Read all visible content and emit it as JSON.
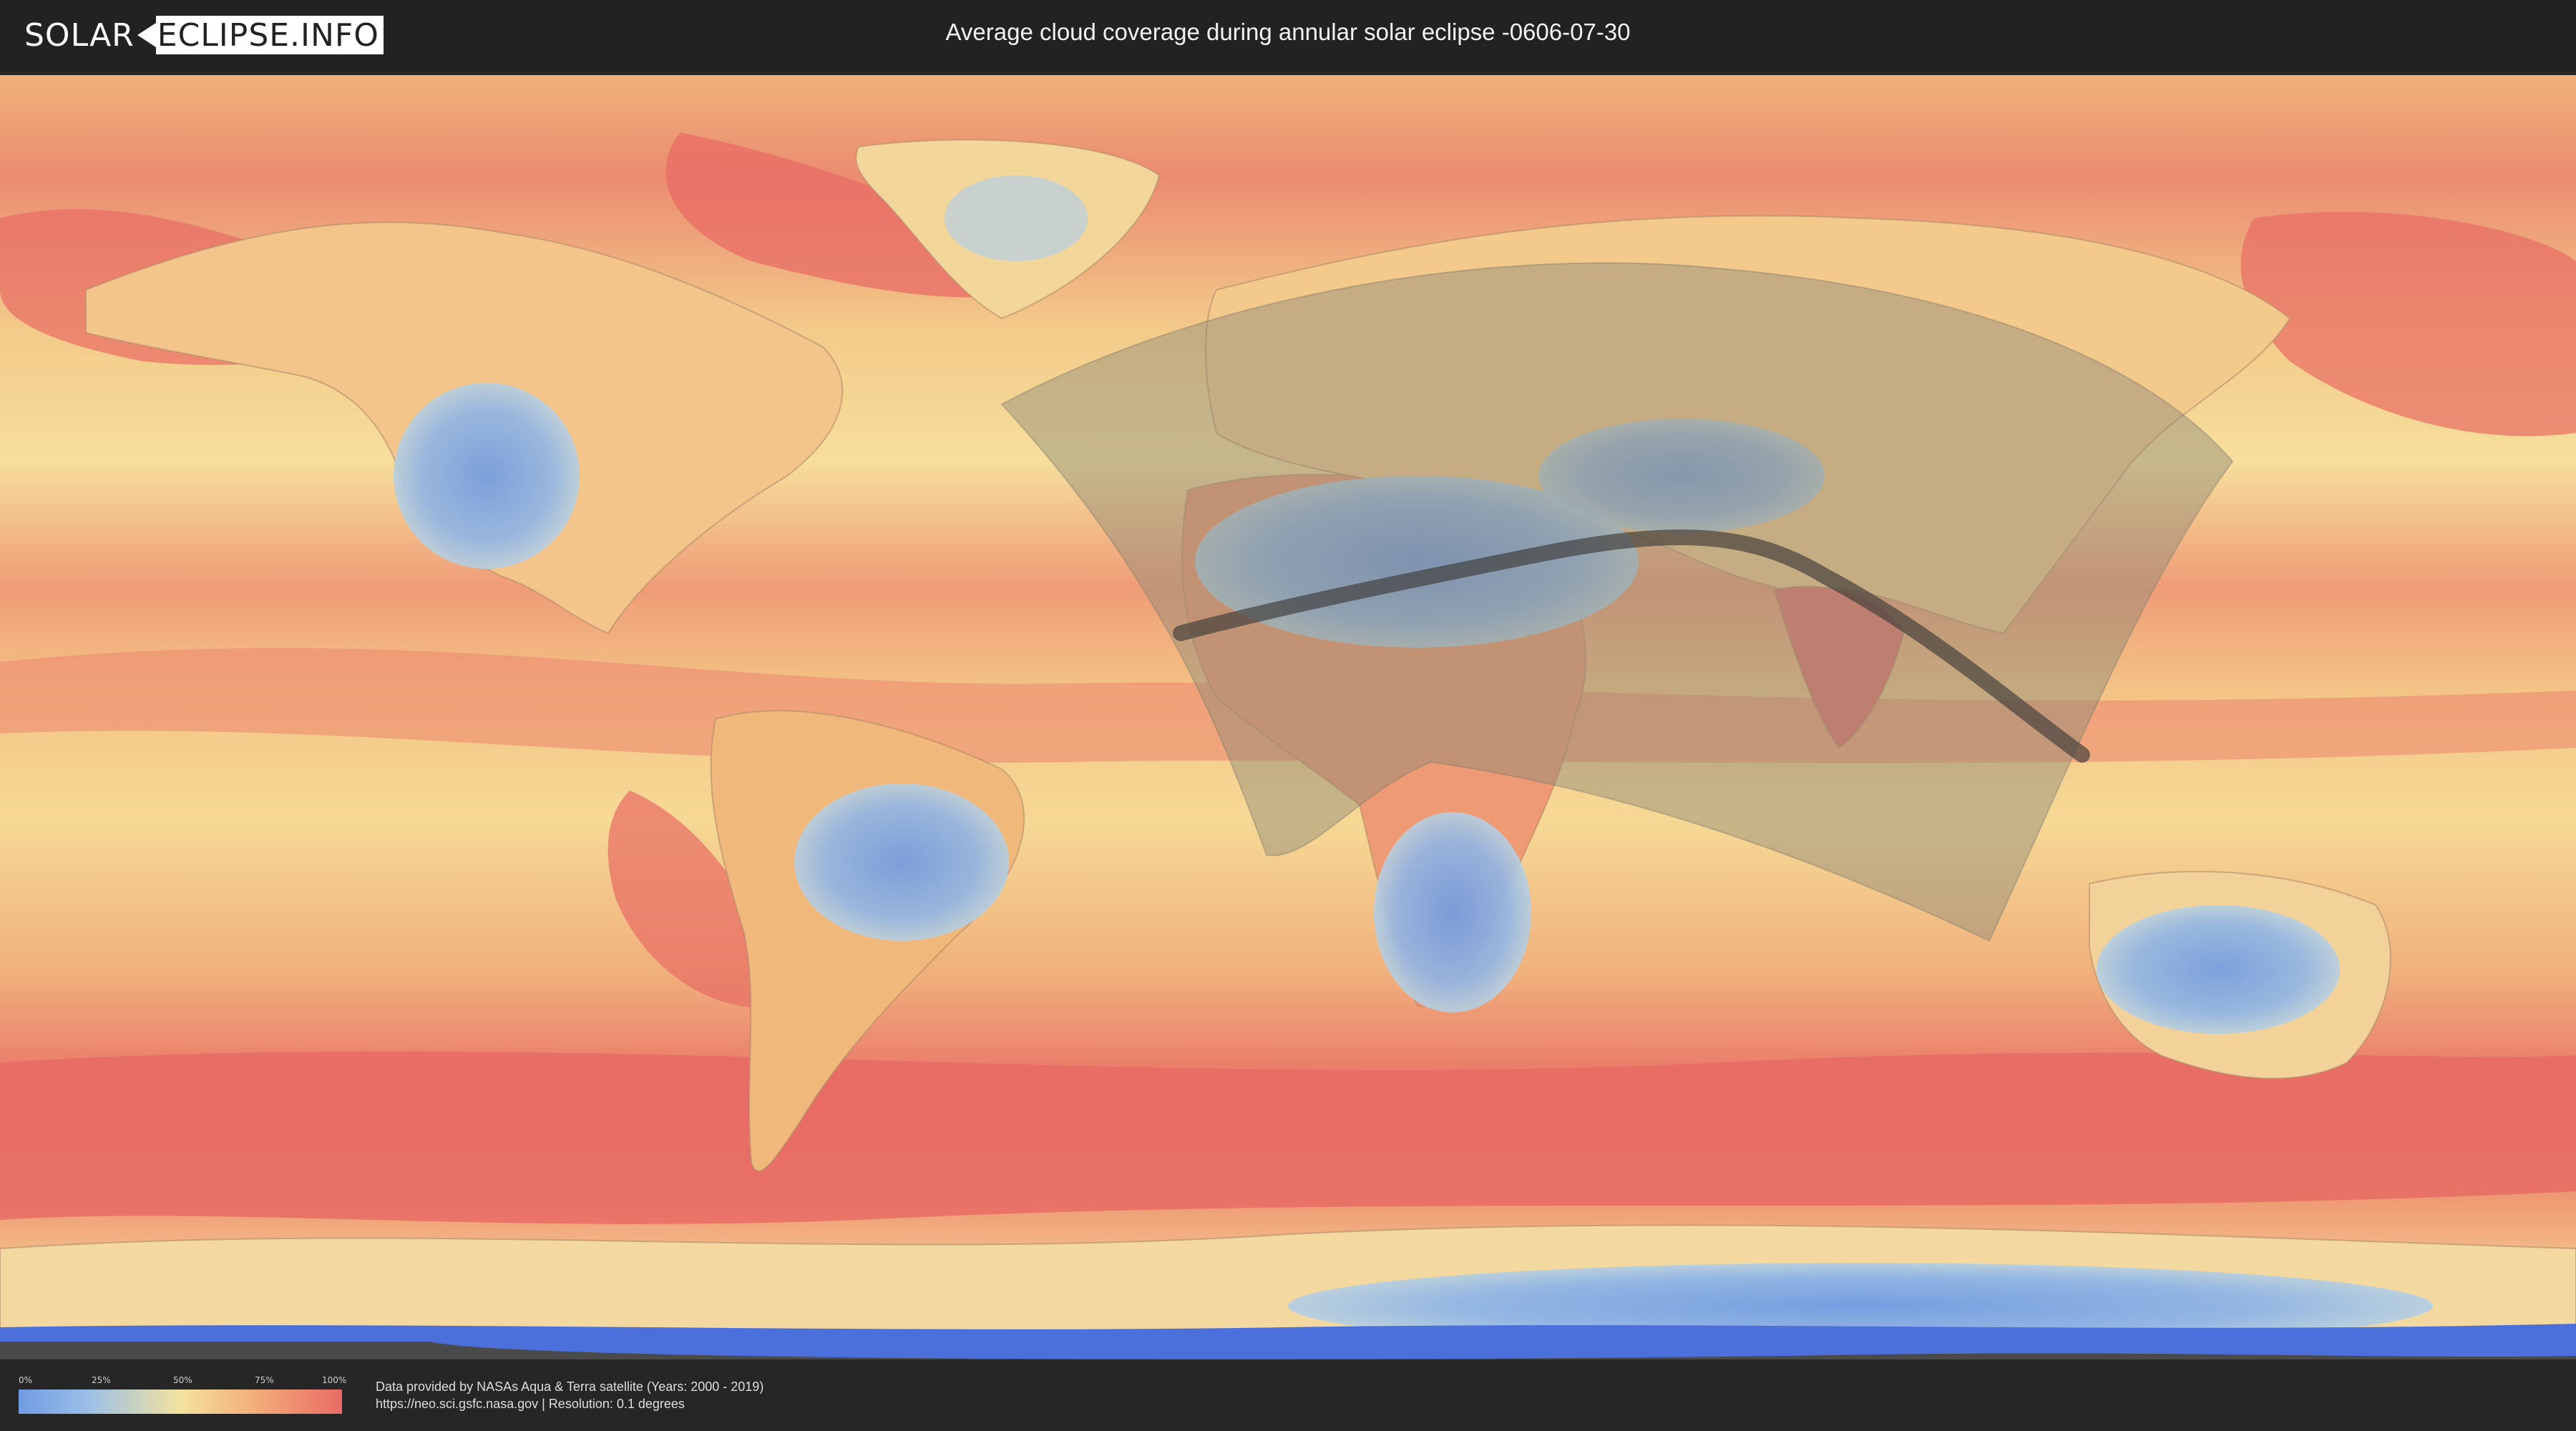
{
  "header": {
    "logo_left": "SOLAR",
    "logo_right": "ECLIPSE.INFO",
    "title": "Average cloud coverage during annular solar eclipse -0606-07-30"
  },
  "map": {
    "projection": "equirectangular",
    "layer": "average cloud coverage",
    "eclipse_type": "annular",
    "eclipse_date": "-0606-07-30",
    "colors": {
      "clear": "#6f9be3",
      "low": "#9dc0e6",
      "mid": "#f3e29e",
      "high": "#f3b07a",
      "overcast": "#e96b64",
      "visibility_zone": "#8c8a78",
      "central_path": "#3d3b38"
    }
  },
  "legend": {
    "ticks": [
      "0%",
      "25%",
      "50%",
      "75%",
      "100%"
    ]
  },
  "footer": {
    "credit_line1": "Data provided by NASAs Aqua & Terra satellite (Years: 2000 - 2019)",
    "credit_line2": "https://neo.sci.gsfc.nasa.gov | Resolution: 0.1 degrees"
  }
}
